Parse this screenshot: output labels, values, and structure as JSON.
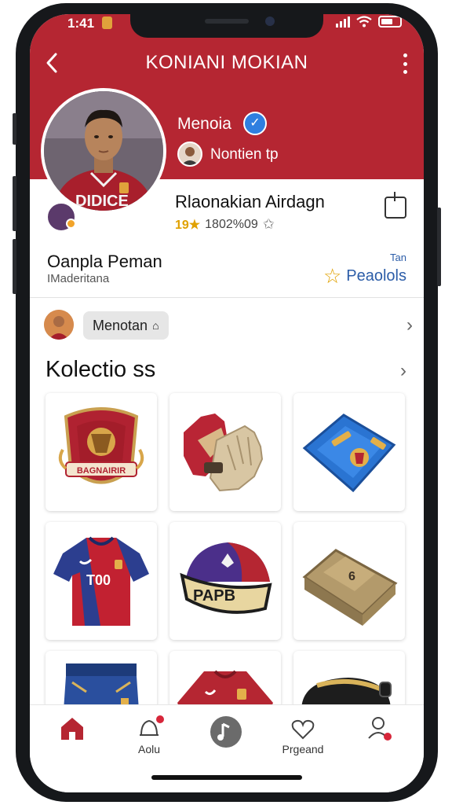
{
  "status_bar": {
    "time": "1:41"
  },
  "header": {
    "title": "KONIANI MOKIAN"
  },
  "profile": {
    "verified_name": "Menoia",
    "sub_label": "Nontien tp",
    "name": "Rlaonakian Airdagn",
    "rating": "19★",
    "count": "1802%09",
    "jersey_text": "DIDICE"
  },
  "section": {
    "title": "Oanpla Peman",
    "subtitle": "IMaderitana",
    "fav_small": "Tan",
    "fav_label": "Peaolols"
  },
  "mention": {
    "label": "Menotan"
  },
  "collection": {
    "title": "Kolectio ss",
    "items": [
      {
        "name": "crest",
        "label": "BAGNAIRIR"
      },
      {
        "name": "gloves",
        "label": ""
      },
      {
        "name": "shin-guard",
        "label": ""
      },
      {
        "name": "jersey",
        "label": "T00"
      },
      {
        "name": "cap",
        "label": "PAPB"
      },
      {
        "name": "wallet",
        "label": ""
      },
      {
        "name": "shorts",
        "label": ""
      },
      {
        "name": "shirt",
        "label": ""
      },
      {
        "name": "bag",
        "label": ""
      }
    ]
  },
  "tabbar": {
    "tabs": [
      {
        "label": ""
      },
      {
        "label": "Aolu"
      },
      {
        "label": ""
      },
      {
        "label": "Prgeand"
      },
      {
        "label": ""
      }
    ]
  },
  "colors": {
    "accent": "#b52632",
    "blue": "#2f7fe0",
    "gold": "#e0a100"
  }
}
